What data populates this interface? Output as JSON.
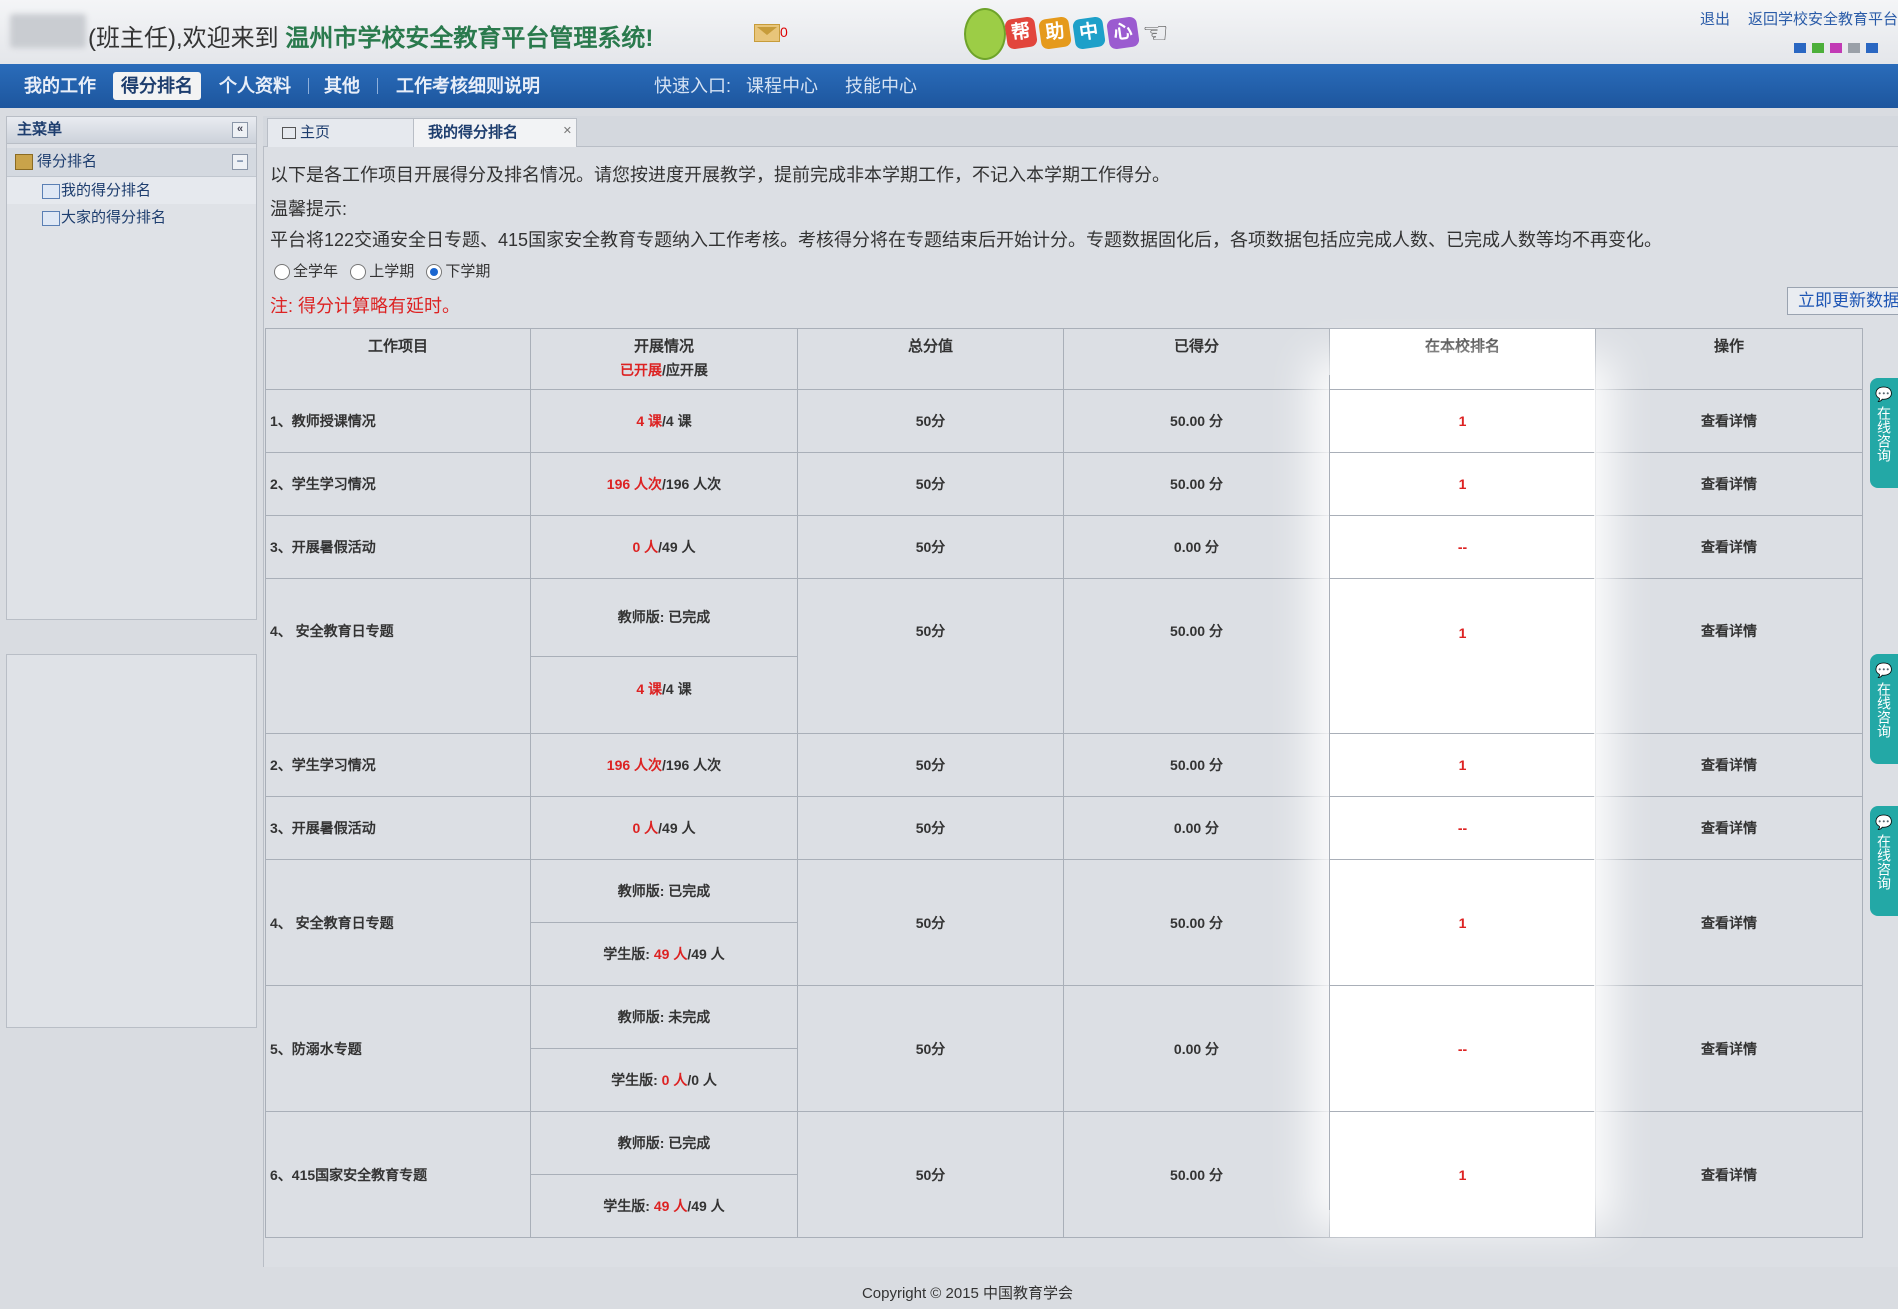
{
  "header": {
    "welcome_prefix": "(班主任),欢迎来到",
    "system_name": "温州市学校安全教育平台管理系统!",
    "mail_count": "0",
    "help_chars": [
      "帮",
      "助",
      "中",
      "心"
    ],
    "help_colors": [
      "#e2453c",
      "#e59a1c",
      "#1ea0c9",
      "#9b5bd0"
    ],
    "logout": "退出",
    "back_link": "返回学校安全教育平台",
    "swatch_colors": [
      "#2a67c2",
      "#4caf3a",
      "#c23ab5",
      "#9aa0a8",
      "#2a67c2"
    ]
  },
  "nav": {
    "items": [
      "我的工作",
      "得分排名",
      "个人资料",
      "其他",
      "工作考核细则说明"
    ],
    "quick_label": "快速入口:",
    "quick_links": [
      "课程中心",
      "技能中心"
    ]
  },
  "sidebar": {
    "title": "主菜单",
    "group": "得分排名",
    "items": [
      "我的得分排名",
      "大家的得分排名"
    ]
  },
  "tabs": [
    "主页",
    "我的得分排名"
  ],
  "notice": {
    "line1": "以下是各工作项目开展得分及排名情况。请您按进度开展教学，提前完成非本学期工作，不记入本学期工作得分。",
    "line2": "温馨提示:",
    "line3": "平台将122交通安全日专题、415国家安全教育专题纳入工作考核。考核得分将在专题结束后开始计分。专题数据固化后，各项数据包括应完成人数、已完成人数等均不再变化。",
    "radios": [
      "全学年",
      "上学期",
      "下学期"
    ],
    "selected_radio": "下学期",
    "delay_note": "注:  得分计算略有延时。",
    "refresh_button": "立即更新数据"
  },
  "table": {
    "headers": [
      "工作项目",
      "开展情况",
      "总分值",
      "已得分",
      "在本校排名",
      "操作"
    ],
    "sub_header_red": "已开展",
    "sub_header_rest": "/应开展",
    "detail_link": "查看详情",
    "rows": {
      "r1": {
        "name": "1、教师授课情况",
        "done": "4 课",
        "total": "/4 课",
        "full": "50分",
        "score": "50.00 分",
        "rank": "1"
      },
      "r2": {
        "name": "2、学生学习情况",
        "done": "196 人次",
        "total": "/196 人次",
        "full": "50分",
        "score": "50.00 分",
        "rank": "1"
      },
      "r3": {
        "name": "3、开展暑假活动",
        "done": "0 人",
        "total": "/49 人",
        "full": "50分",
        "score": "0.00 分",
        "rank": "--"
      },
      "r4": {
        "name": "4、 安全教育日专题",
        "status": "教师版: 已完成",
        "full": "50分",
        "score": "50.00 分",
        "rank": "1"
      },
      "r5": {
        "name": "1、教师授课情况",
        "done": "4 课",
        "total": "/4 课",
        "full": "50分",
        "score": "50.00 分",
        "rank": "1"
      },
      "r6": {
        "name": "2、学生学习情况",
        "done": "196 人次",
        "total": "/196 人次",
        "full": "50分",
        "score": "50.00 分",
        "rank": "1"
      },
      "r7": {
        "name": "3、开展暑假活动",
        "done": "0 人",
        "total": "/49 人",
        "full": "50分",
        "score": "0.00 分",
        "rank": "--"
      },
      "r8": {
        "name": "4、 安全教育日专题",
        "teacher": "教师版: 已完成",
        "student_prefix": "学生版: ",
        "student_done": "49 人",
        "student_total": "/49 人",
        "full": "50分",
        "score": "50.00 分",
        "rank": "1"
      },
      "r9": {
        "name": "5、防溺水专题",
        "teacher": "教师版: 未完成",
        "student_prefix": "学生版: ",
        "student_done": "0 人",
        "student_total": "/0 人",
        "full": "50分",
        "score": "0.00 分",
        "rank": "--"
      },
      "r10": {
        "name": "6、415国家安全教育专题",
        "teacher": "教师版: 已完成",
        "student_prefix": "学生版: ",
        "student_done": "49 人",
        "student_total": "/49 人",
        "full": "50分",
        "score": "50.00 分",
        "rank": "1"
      }
    }
  },
  "chat_label": "在线咨询",
  "footer": "Copyright © 2015 中国教育学会"
}
